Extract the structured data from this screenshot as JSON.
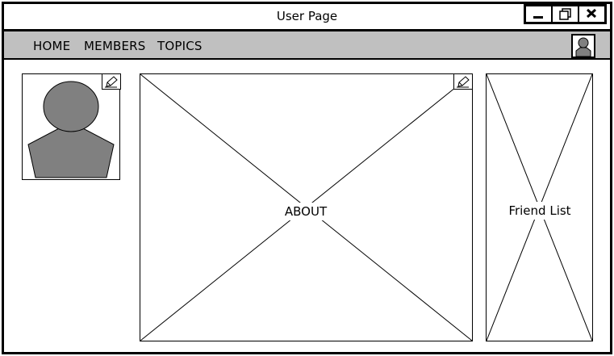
{
  "window": {
    "title": "User Page",
    "controls": [
      "minimize-icon",
      "restore-icon",
      "close-icon"
    ]
  },
  "nav": {
    "items": [
      {
        "label": "HOME"
      },
      {
        "label": "MEMBERS"
      },
      {
        "label": "TOPICS"
      }
    ],
    "user_icon": "user-avatar-icon"
  },
  "profile": {
    "photo_icon": "profile-silhouette-icon",
    "edit_icon": "pencil-icon"
  },
  "about": {
    "label": "ABOUT",
    "edit_icon": "pencil-icon"
  },
  "friends": {
    "label": "Friend List"
  },
  "colors": {
    "navbar_bg": "#c0c0c0",
    "silhouette": "#808080",
    "border": "#000000"
  }
}
